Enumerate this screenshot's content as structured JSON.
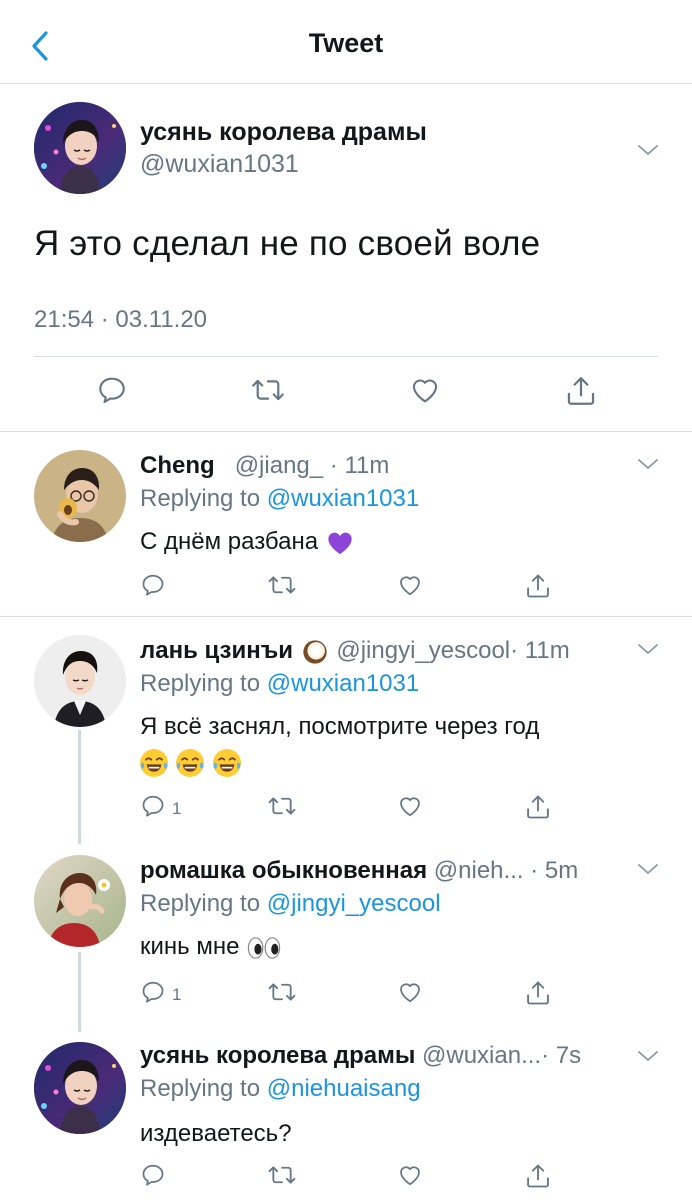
{
  "header": {
    "title": "Tweet"
  },
  "main_tweet": {
    "name": "усянь королева драмы",
    "handle": "@wuxian1031",
    "text": "Я это сделал не по своей воле",
    "timestamp": "21:54 · 03.11.20"
  },
  "replies": [
    {
      "name": "Cheng",
      "handle": "@jiang_",
      "time": "· 11m",
      "replying_label": "Replying to",
      "replying_to": "@wuxian1031",
      "text": "С днём разбана",
      "emoji": "purple-heart",
      "reply_count": ""
    },
    {
      "name": "лань цзинъи",
      "name_emoji": "coconut",
      "handle": "@jingyi_yescool",
      "time": "· 11m",
      "replying_label": "Replying to",
      "replying_to": "@wuxian1031",
      "text": "Я всё заснял, посмотрите через год",
      "emoji": "joy-x3",
      "reply_count": "1"
    },
    {
      "name": "ромашка обыкновенная",
      "handle": "@nieh...",
      "time": "· 5m",
      "replying_label": "Replying to",
      "replying_to": "@jingyi_yescool",
      "text": "кинь мне",
      "emoji": "eyes",
      "reply_count": "1"
    },
    {
      "name": "усянь королева драмы",
      "handle": "@wuxian...",
      "time": "· 7s",
      "replying_label": "Replying to",
      "replying_to": "@niehuaisang",
      "text": "издеваетесь?",
      "reply_count": ""
    }
  ],
  "colors": {
    "accent": "#1b95e0",
    "text": "#14171a",
    "secondary": "#657786",
    "divider": "#dcdfe2",
    "heart_emoji": "#8e44d9"
  },
  "icons": [
    "back-chevron-icon",
    "chevron-down-icon",
    "reply-icon",
    "retweet-icon",
    "like-icon",
    "share-icon",
    "purple-heart-emoji",
    "coconut-emoji",
    "joy-emoji",
    "eyes-emoji"
  ]
}
